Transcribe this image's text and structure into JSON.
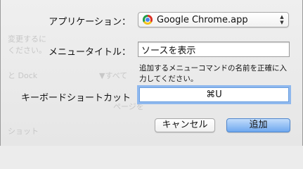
{
  "dialog": {
    "application_label": "アプリケーション：",
    "application_value": "Google Chrome.app",
    "menu_title_label": "メニュータイトル：",
    "menu_title_value": "ソースを表示",
    "hint": "追加するメニューコマンドの名前を正確に入力してください。",
    "shortcut_label": "キーボードショートカット",
    "shortcut_value": "⌘U",
    "cancel_label": "キャンセル",
    "add_label": "追加"
  },
  "background_text": {
    "t1": "変更するに",
    "t2": "ください。",
    "t3": "と Dock",
    "t4": "▼すべて",
    "t5": "ページを",
    "t6": "ショット"
  },
  "colors": {
    "accent": "#6fa8ef",
    "focus_ring": "#8fb8ee"
  }
}
